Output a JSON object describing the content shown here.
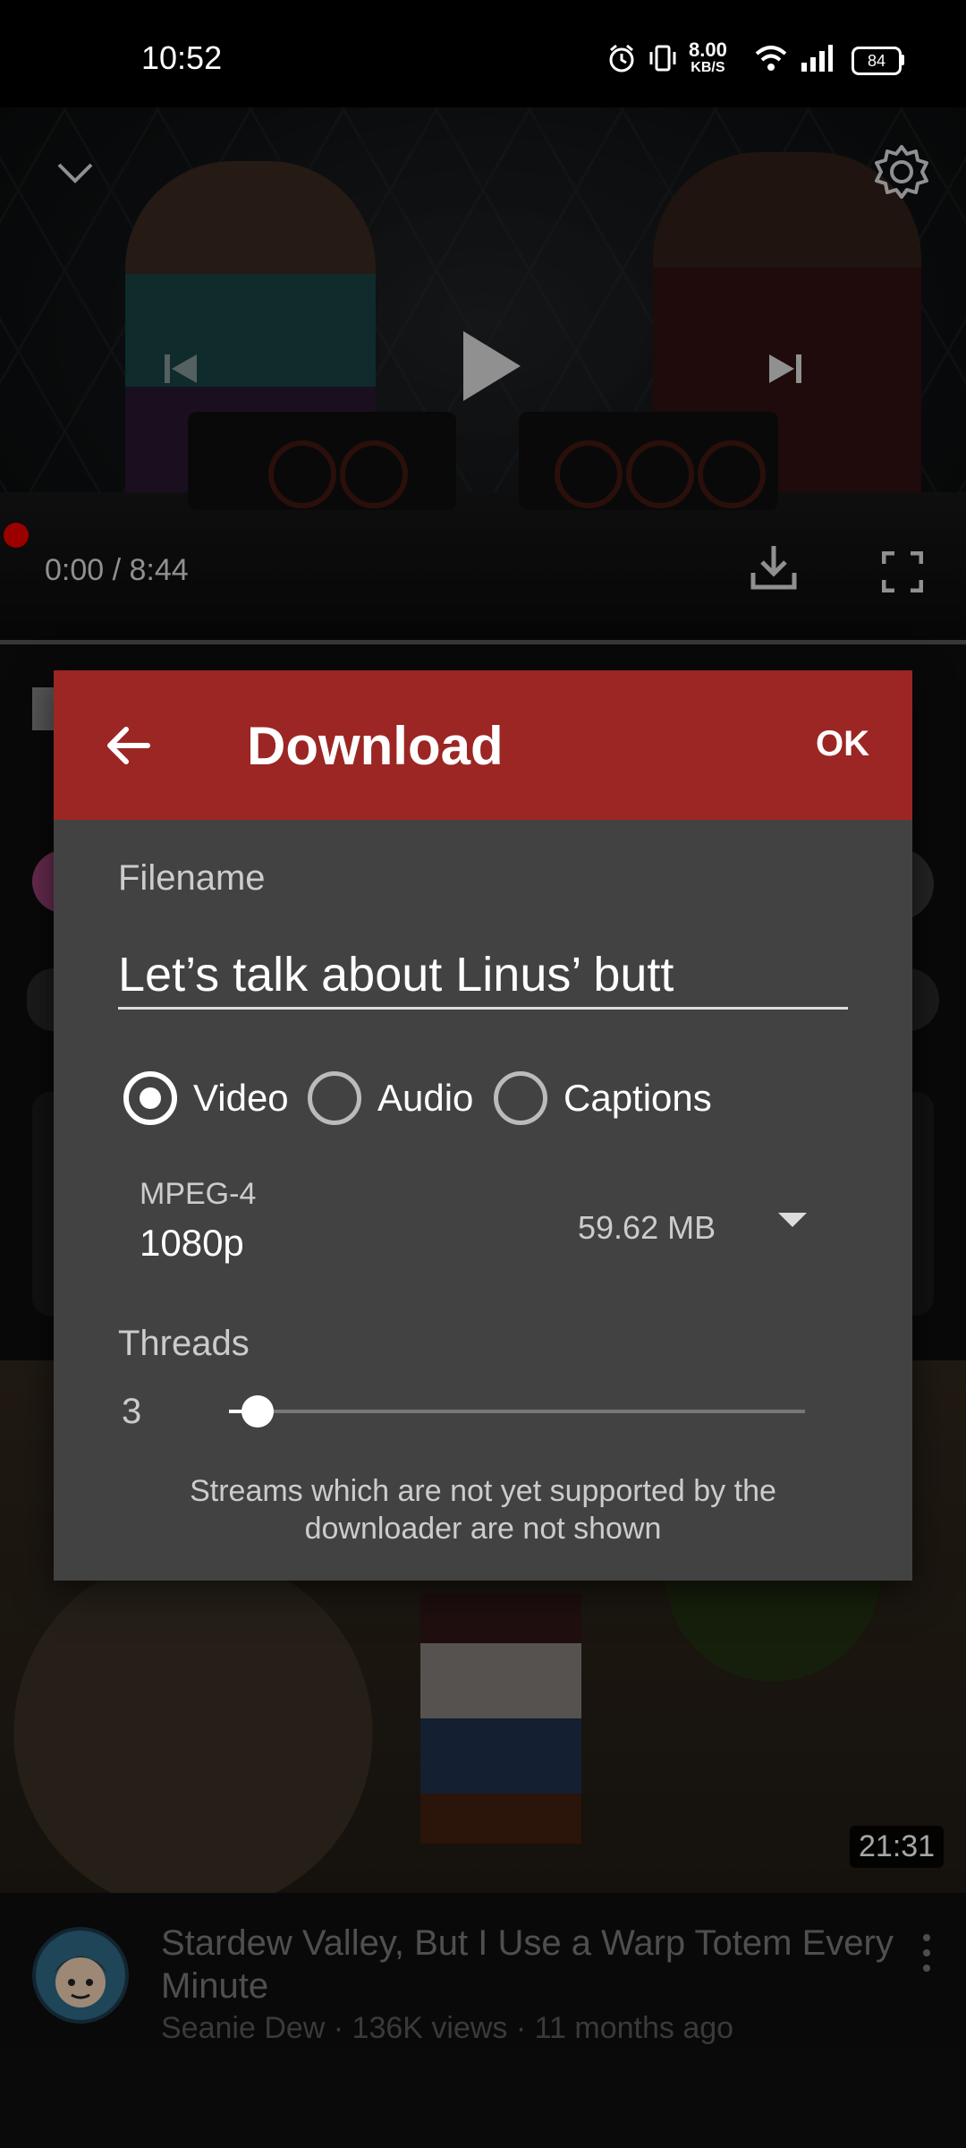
{
  "status_bar": {
    "time": "10:52",
    "net_speed_value": "8.00",
    "net_speed_unit": "KB/S",
    "battery": "84"
  },
  "player": {
    "time_readout": "0:00 / 8:44"
  },
  "dialog": {
    "title": "Download",
    "ok_label": "OK",
    "filename_label": "Filename",
    "filename_value": "Let’s talk about Linus’ butt",
    "radio_options": [
      {
        "label": "Video",
        "selected": true
      },
      {
        "label": "Audio",
        "selected": false
      },
      {
        "label": "Captions",
        "selected": false
      }
    ],
    "format_name": "MPEG-4",
    "format_resolution": "1080p",
    "format_size": "59.62 MB",
    "threads_label": "Threads",
    "threads_value": "3",
    "threads_level": 0.05,
    "notice": "Streams which are not yet supported by the downloader are not shown"
  },
  "next_video": {
    "duration": "21:31",
    "title": "Stardew Valley, But I Use a Warp Totem Every Minute",
    "meta": "Seanie Dew · 136K views · 11 months ago"
  },
  "colors": {
    "dialog_header": "#9b2623",
    "dialog_body": "#424242",
    "progress_thumb": "#ee0000"
  }
}
